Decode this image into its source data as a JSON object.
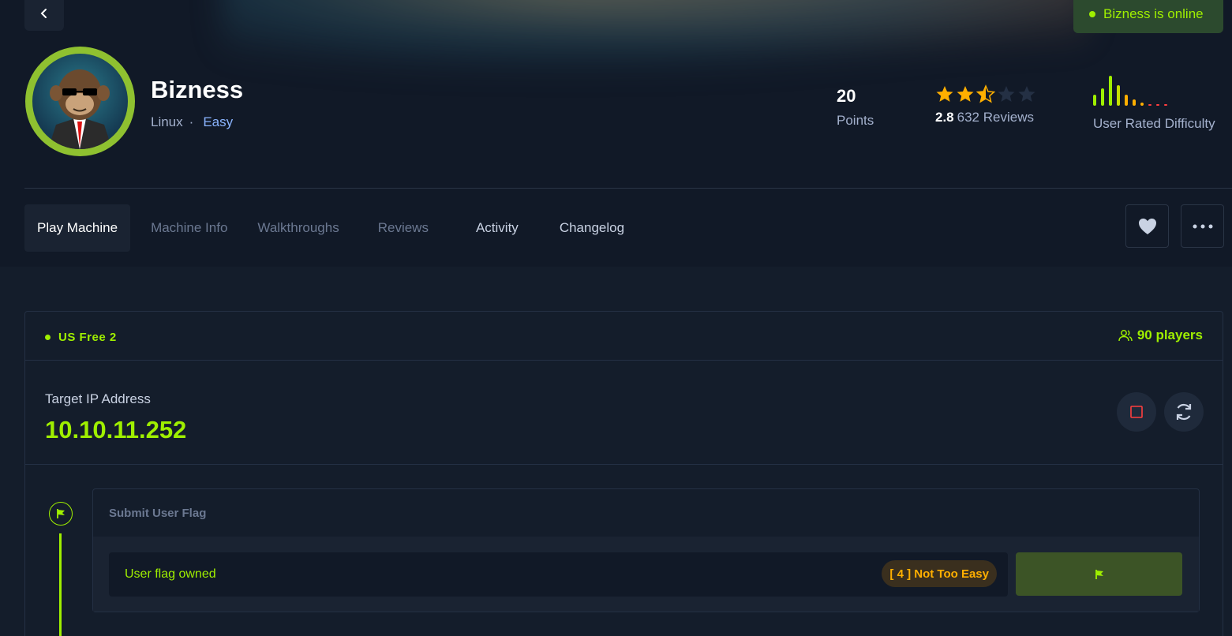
{
  "status": {
    "online_text": "Bizness is online"
  },
  "machine": {
    "name": "Bizness",
    "os": "Linux",
    "separator": "·",
    "difficulty": "Easy"
  },
  "stats": {
    "points_value": "20",
    "points_label": "Points",
    "rating_value": "2.8",
    "reviews_text": "632 Reviews",
    "stars_rating": 2.5,
    "difficulty_label": "User Rated Difficulty",
    "difficulty_colors": {
      "green": "#9fef00",
      "orange": "#ffaf00",
      "red": "#ff3e3e"
    }
  },
  "tabs": [
    {
      "label": "Play Machine"
    },
    {
      "label": "Machine Info"
    },
    {
      "label": "Walkthroughs"
    },
    {
      "label": "Reviews"
    },
    {
      "label": "Activity"
    },
    {
      "label": "Changelog"
    }
  ],
  "actions": {
    "favorite_icon": "heart-icon",
    "more_icon": "more-dots-icon"
  },
  "server": {
    "name": "US Free 2",
    "players": "90 players"
  },
  "target": {
    "label": "Target IP Address",
    "ip": "10.10.11.252"
  },
  "user_flag": {
    "title": "Submit User Flag",
    "status": "User flag owned",
    "difficulty_badge": "[ 4 ] Not Too Easy"
  }
}
